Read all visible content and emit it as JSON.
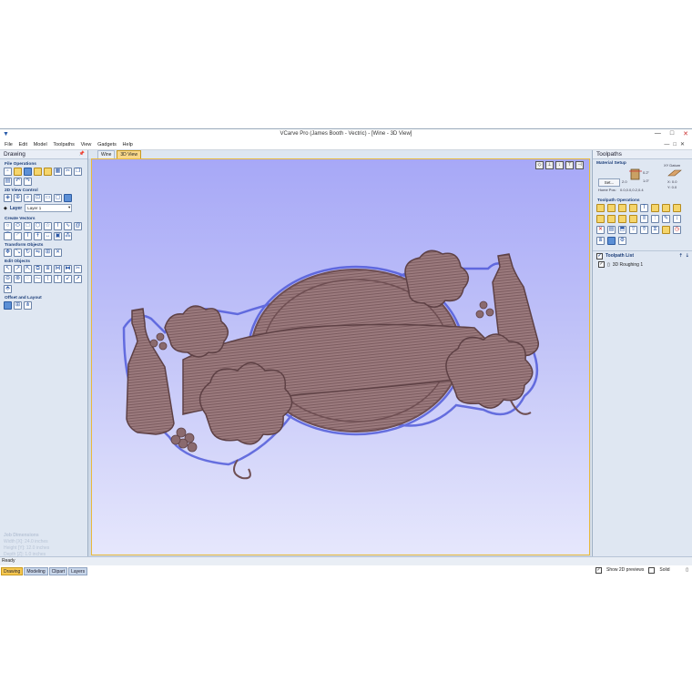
{
  "window": {
    "title": "VCarve Pro (James Booth - Vectric) - [Wine - 3D View]",
    "controls": [
      "—",
      "□",
      "✕"
    ],
    "mdi_controls": [
      "—",
      "□",
      "✕"
    ]
  },
  "menu": [
    "File",
    "Edit",
    "Model",
    "Toolpaths",
    "View",
    "Gadgets",
    "Help"
  ],
  "drawing_panel": {
    "title": "Drawing",
    "sections": {
      "file_operations": "File Operations",
      "view_control": "2D View Control",
      "create_vectors": "Create Vectors",
      "transform_objects": "Transform Objects",
      "edit_objects": "Edit Objects",
      "offset_layout": "Offset and Layout"
    },
    "layer_label": "Layer",
    "layer_value": "Layer 1"
  },
  "job_dimensions": {
    "heading": "Job Dimensions",
    "width": "Width  [X]: 24.0 inches",
    "height": "Height [Y]: 12.0 inches",
    "depth": "Depth  [Z]: 1.0 inches"
  },
  "left_tabs": [
    "Drawing",
    "Modeling",
    "Clipart",
    "Layers"
  ],
  "doc_tabs": [
    "Wine",
    "3D View"
  ],
  "toolpaths_panel": {
    "title": "Toolpaths",
    "material_setup": "Material Setup",
    "set_button": "Set...",
    "xy_datum": "XY Datum",
    "home_pos": "Home Pos:",
    "home_val": "0.0,0.0,0.2,0.4",
    "x_val": "X: 0.0",
    "y_val": "Y: 0.0",
    "z_top": "0.2\"",
    "z_bottom": "1.0\"",
    "depth_val": "2.0",
    "toolpath_operations": "Toolpath Operations",
    "toolpath_list": "Toolpath List",
    "toolpaths": [
      "3D Roughing 1"
    ],
    "show_2d": "Show 2D previews",
    "solid": "Solid"
  },
  "status": "Ready",
  "colors": {
    "wood": "#9b7a7d",
    "wood_dark": "#6f4f53",
    "viewport_top": "#a7a8f7",
    "viewport_bottom": "#e6e7fc",
    "accent": "#f7c850"
  }
}
